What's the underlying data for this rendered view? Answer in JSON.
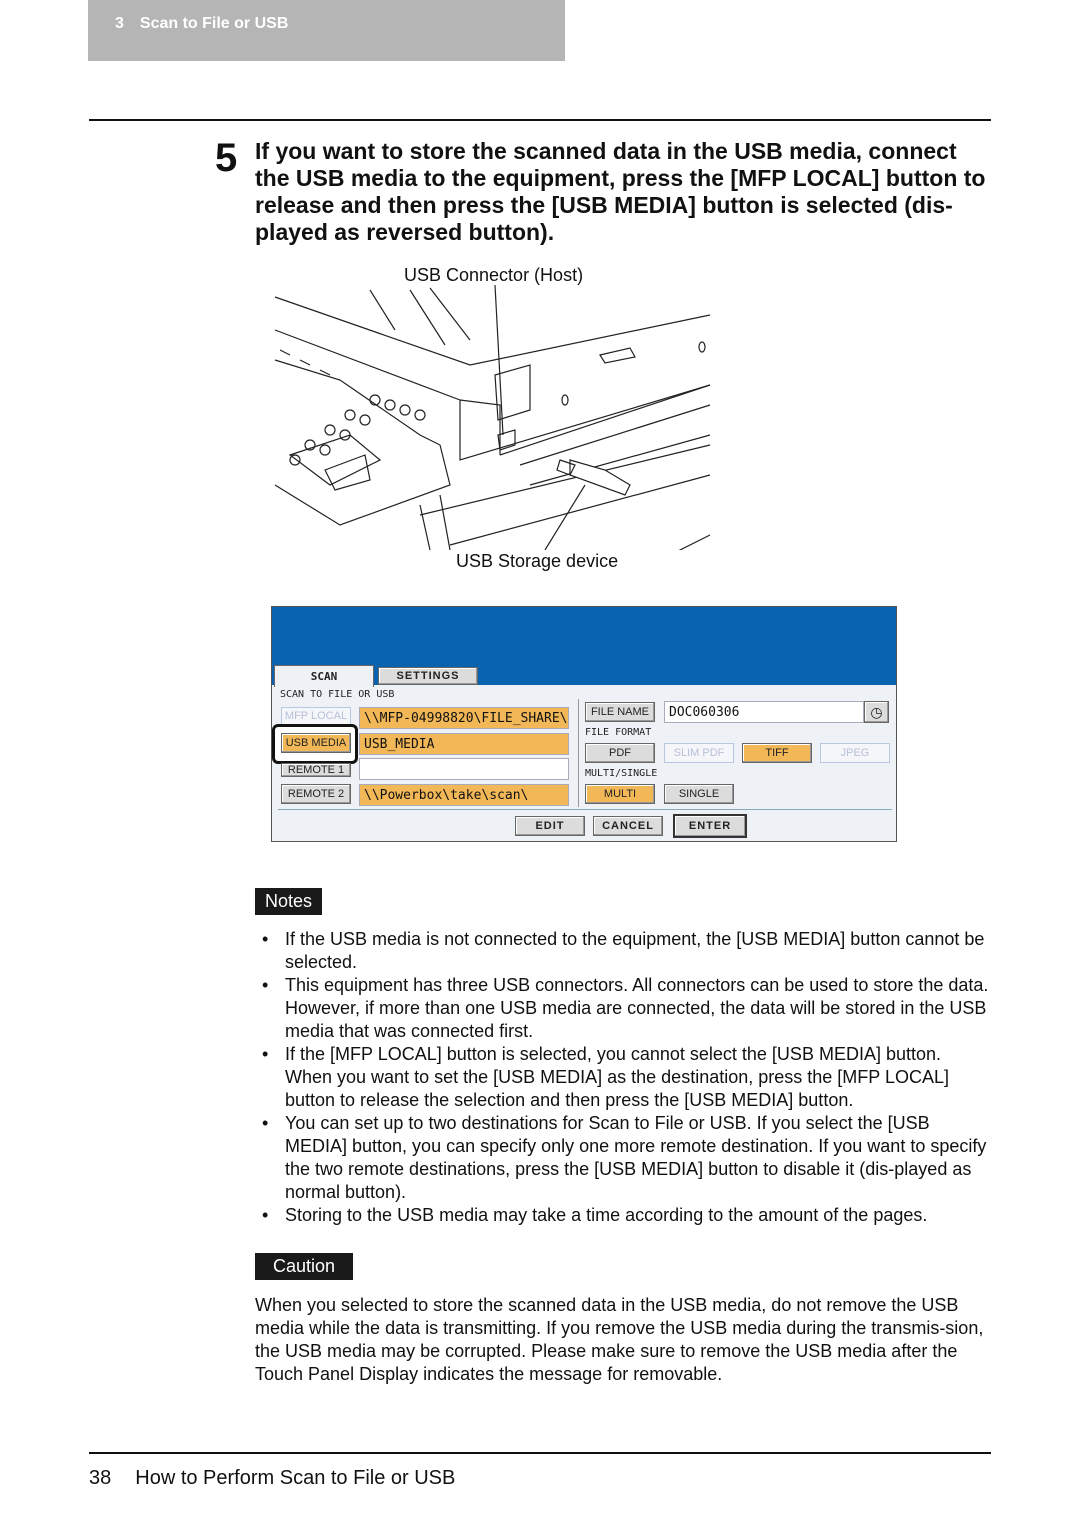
{
  "header": {
    "chapter": "3",
    "title": "Scan to File or USB"
  },
  "step": {
    "number": "5",
    "text": "If you want to store the scanned data in the USB media, connect the USB media to the equipment, press the [MFP LOCAL] button to release and then press the [USB MEDIA] button is selected (dis-played as reversed button)."
  },
  "figure": {
    "caption_top": "USB Connector (Host)",
    "caption_bottom": "USB Storage device"
  },
  "panel": {
    "tabs": [
      "SCAN",
      "SETTINGS"
    ],
    "section_label": "SCAN TO FILE OR USB",
    "dest_buttons": [
      "MFP LOCAL",
      "USB MEDIA",
      "REMOTE 1",
      "REMOTE 2"
    ],
    "dest_paths": [
      "\\\\MFP-04998820\\FILE_SHARE\\",
      "USB_MEDIA",
      "",
      "\\\\Powerbox\\take\\scan\\"
    ],
    "file_name_label": "FILE NAME",
    "file_name_value": "DOC060306",
    "file_format_label": "FILE FORMAT",
    "formats": [
      "PDF",
      "SLIM PDF",
      "TIFF",
      "JPEG"
    ],
    "multi_single_label": "MULTI/SINGLE",
    "multi_single": [
      "MULTI",
      "SINGLE"
    ],
    "actions": [
      "EDIT",
      "CANCEL",
      "ENTER"
    ],
    "colors": {
      "header": "#0a63b0",
      "selected": "#f2b858"
    }
  },
  "notes": {
    "label": "Notes",
    "items": [
      "If the USB media is not connected to the equipment, the [USB MEDIA] button cannot be selected.",
      "This equipment has three USB connectors.  All connectors can be used to store the data.  However, if more than one USB media are connected, the data will be stored in the USB media that was connected first.",
      "If the [MFP LOCAL] button is selected, you cannot select the [USB MEDIA] button. When you want to set the [USB MEDIA] as the destination, press the [MFP LOCAL] button to release the selection and then press the [USB MEDIA] button.",
      "You can set up to two destinations for Scan to File or USB.  If you select the [USB MEDIA] button, you can specify only one more remote destination.  If you want to specify the two remote destinations, press the [USB MEDIA] button to disable it (dis-played as normal button).",
      "Storing to the USB media may take a time according to the amount of the pages."
    ]
  },
  "caution": {
    "label": "Caution",
    "text": "When you selected to store the scanned data in the USB media, do not remove the USB media while the data is transmitting.  If you remove the USB media during the transmis-sion, the USB media may be corrupted.  Please make sure to remove the USB media after the Touch Panel Display indicates the message for removable."
  },
  "footer": {
    "page": "38",
    "title": "How to Perform Scan to File or USB"
  }
}
